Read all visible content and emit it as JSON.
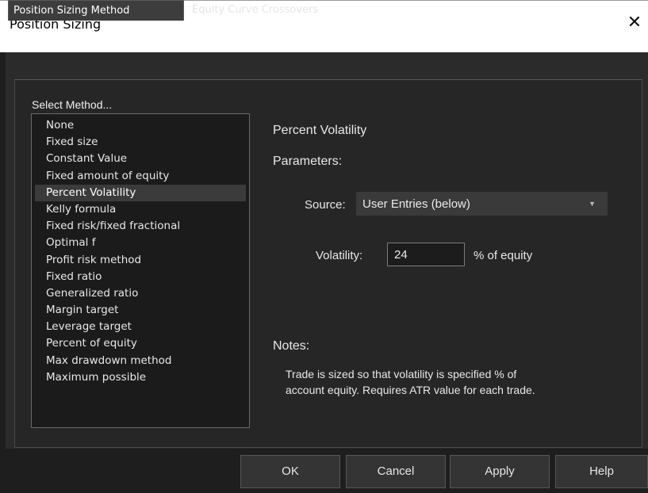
{
  "window": {
    "title": "Position Sizing",
    "close_glyph": "✕"
  },
  "tabs": [
    {
      "label": "Position Sizing Method",
      "active": true
    },
    {
      "label": "Equity Curve Crossovers",
      "active": false
    }
  ],
  "methods": {
    "label": "Select Method...",
    "items": [
      "None",
      "Fixed size",
      "Constant Value",
      "Fixed amount of equity",
      "Percent Volatility",
      "Kelly formula",
      "Fixed risk/fixed fractional",
      "Optimal f",
      "Profit risk method",
      "Fixed ratio",
      "Generalized ratio",
      "Margin target",
      "Leverage target",
      "Percent of equity",
      "Max drawdown method",
      "Maximum possible"
    ],
    "selected": "Percent Volatility"
  },
  "details": {
    "method_title": "Percent Volatility",
    "parameters_label": "Parameters:",
    "source_label": "Source:",
    "source_value": "User Entries (below)",
    "volatility_label": "Volatility:",
    "volatility_value": "24",
    "volatility_suffix": "% of equity",
    "notes_label": "Notes:",
    "notes_line1": "Trade is sized so that volatility is specified % of",
    "notes_line2": "account equity. Requires ATR value for each trade."
  },
  "buttons": {
    "ok": "OK",
    "cancel": "Cancel",
    "apply": "Apply",
    "help": "Help"
  },
  "colors": {
    "background": "#2b2b2b",
    "panel": "#262626",
    "selected_item": "#3b3b3b",
    "text": "#e8e8e8"
  },
  "icons": {
    "close": "close-icon",
    "dropdown": "chevron-down-icon"
  }
}
